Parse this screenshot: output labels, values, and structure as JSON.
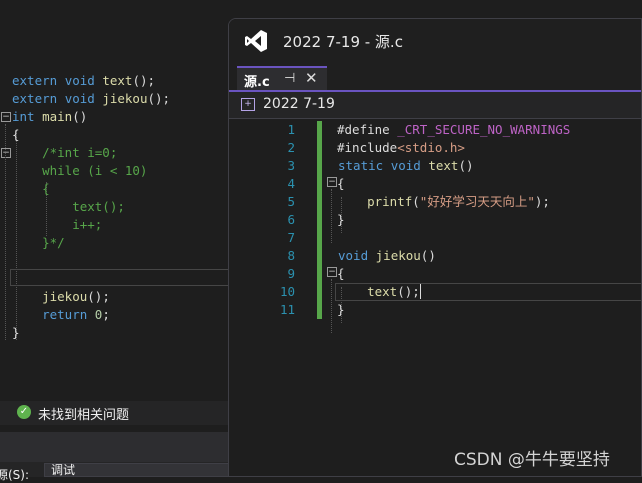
{
  "background_editor": {
    "lines": [
      "extern void text();",
      "extern void jiekou();",
      "int main()",
      "{",
      "    /*int i=0;",
      "    while (i < 10)",
      "    {",
      "        text();",
      "        i++;",
      "    }*/",
      "",
      "",
      "    jiekou();",
      "    return 0;",
      "}"
    ],
    "status_text": "未找到相关问题",
    "output_label": "源(S):",
    "output_source": "调试"
  },
  "window": {
    "title": "2022 7-19 - 源.c",
    "tab_label": "源.c",
    "pin_glyph": "⊣",
    "close_glyph": "✕",
    "nav_project": "2022 7-19",
    "line_numbers": [
      "1",
      "2",
      "3",
      "4",
      "5",
      "6",
      "7",
      "8",
      "9",
      "10",
      "11"
    ],
    "code": [
      "#define _CRT_SECURE_NO_WARNINGS",
      "#include<stdio.h>",
      "static void text()",
      "{",
      "    printf(\"好好学习天天向上\");",
      "}",
      "",
      "void jiekou()",
      "{",
      "    text();",
      "}"
    ]
  },
  "watermark": "CSDN @牛牛要坚持",
  "colors": {
    "accent": "#6a54c0",
    "keyword": "#569cd6",
    "function": "#dcdcaa",
    "comment": "#57a64a",
    "change_bar": "#57a64a"
  },
  "icons": [
    "visual-studio-logo",
    "pin-icon",
    "close-icon",
    "project-icon",
    "check-circle-icon"
  ]
}
